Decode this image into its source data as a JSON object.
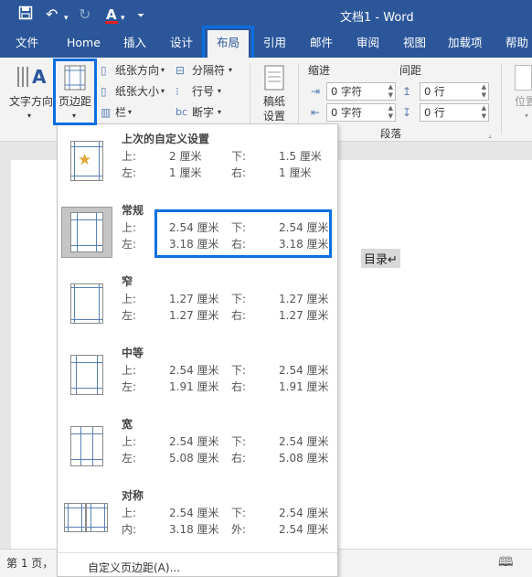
{
  "titlebar": {
    "title": "文档1  -  Word"
  },
  "tabs": [
    "文件",
    "Home",
    "插入",
    "设计",
    "布局",
    "引用",
    "邮件",
    "审阅",
    "视图",
    "加载项",
    "帮助"
  ],
  "ribbon": {
    "text_direction": "文字方向",
    "margins": "页边距",
    "orientation": "纸张方向",
    "size": "纸张大小",
    "columns": "栏",
    "breaks": "分隔符",
    "line_numbers": "行号",
    "hyphenation": "断字",
    "draft_line1": "稿纸",
    "draft_line2": "设置",
    "indent_label": "缩进",
    "spacing_label": "间距",
    "indent_left": "0 字符",
    "indent_right": "0 字符",
    "spacing_before": "0 行",
    "spacing_after": "0 行",
    "paragraph_group": "段落",
    "position_label": "位置"
  },
  "document": {
    "heading_text": "目录↵"
  },
  "statusbar": {
    "page_info": "第 1 页，"
  },
  "margins_menu": {
    "options": [
      {
        "title": "上次的自定义设置",
        "r1": [
          "上:",
          "2 厘米",
          "下:",
          "1.5 厘米"
        ],
        "r2": [
          "左:",
          "1 厘米",
          "右:",
          "1 厘米"
        ]
      },
      {
        "title": "常规",
        "r1": [
          "上:",
          "2.54 厘米",
          "下:",
          "2.54 厘米"
        ],
        "r2": [
          "左:",
          "3.18 厘米",
          "右:",
          "3.18 厘米"
        ]
      },
      {
        "title": "窄",
        "r1": [
          "上:",
          "1.27 厘米",
          "下:",
          "1.27 厘米"
        ],
        "r2": [
          "左:",
          "1.27 厘米",
          "右:",
          "1.27 厘米"
        ]
      },
      {
        "title": "中等",
        "r1": [
          "上:",
          "2.54 厘米",
          "下:",
          "2.54 厘米"
        ],
        "r2": [
          "左:",
          "1.91 厘米",
          "右:",
          "1.91 厘米"
        ]
      },
      {
        "title": "宽",
        "r1": [
          "上:",
          "2.54 厘米",
          "下:",
          "2.54 厘米"
        ],
        "r2": [
          "左:",
          "5.08 厘米",
          "右:",
          "5.08 厘米"
        ]
      },
      {
        "title": "对称",
        "r1": [
          "上:",
          "2.54 厘米",
          "下:",
          "2.54 厘米"
        ],
        "r2": [
          "内:",
          "3.18 厘米",
          "外:",
          "2.54 厘米"
        ]
      }
    ],
    "custom_link": "自定义页边距(A)..."
  },
  "colors": {
    "brand": "#2b579a",
    "highlight": "#0b6fe0"
  }
}
